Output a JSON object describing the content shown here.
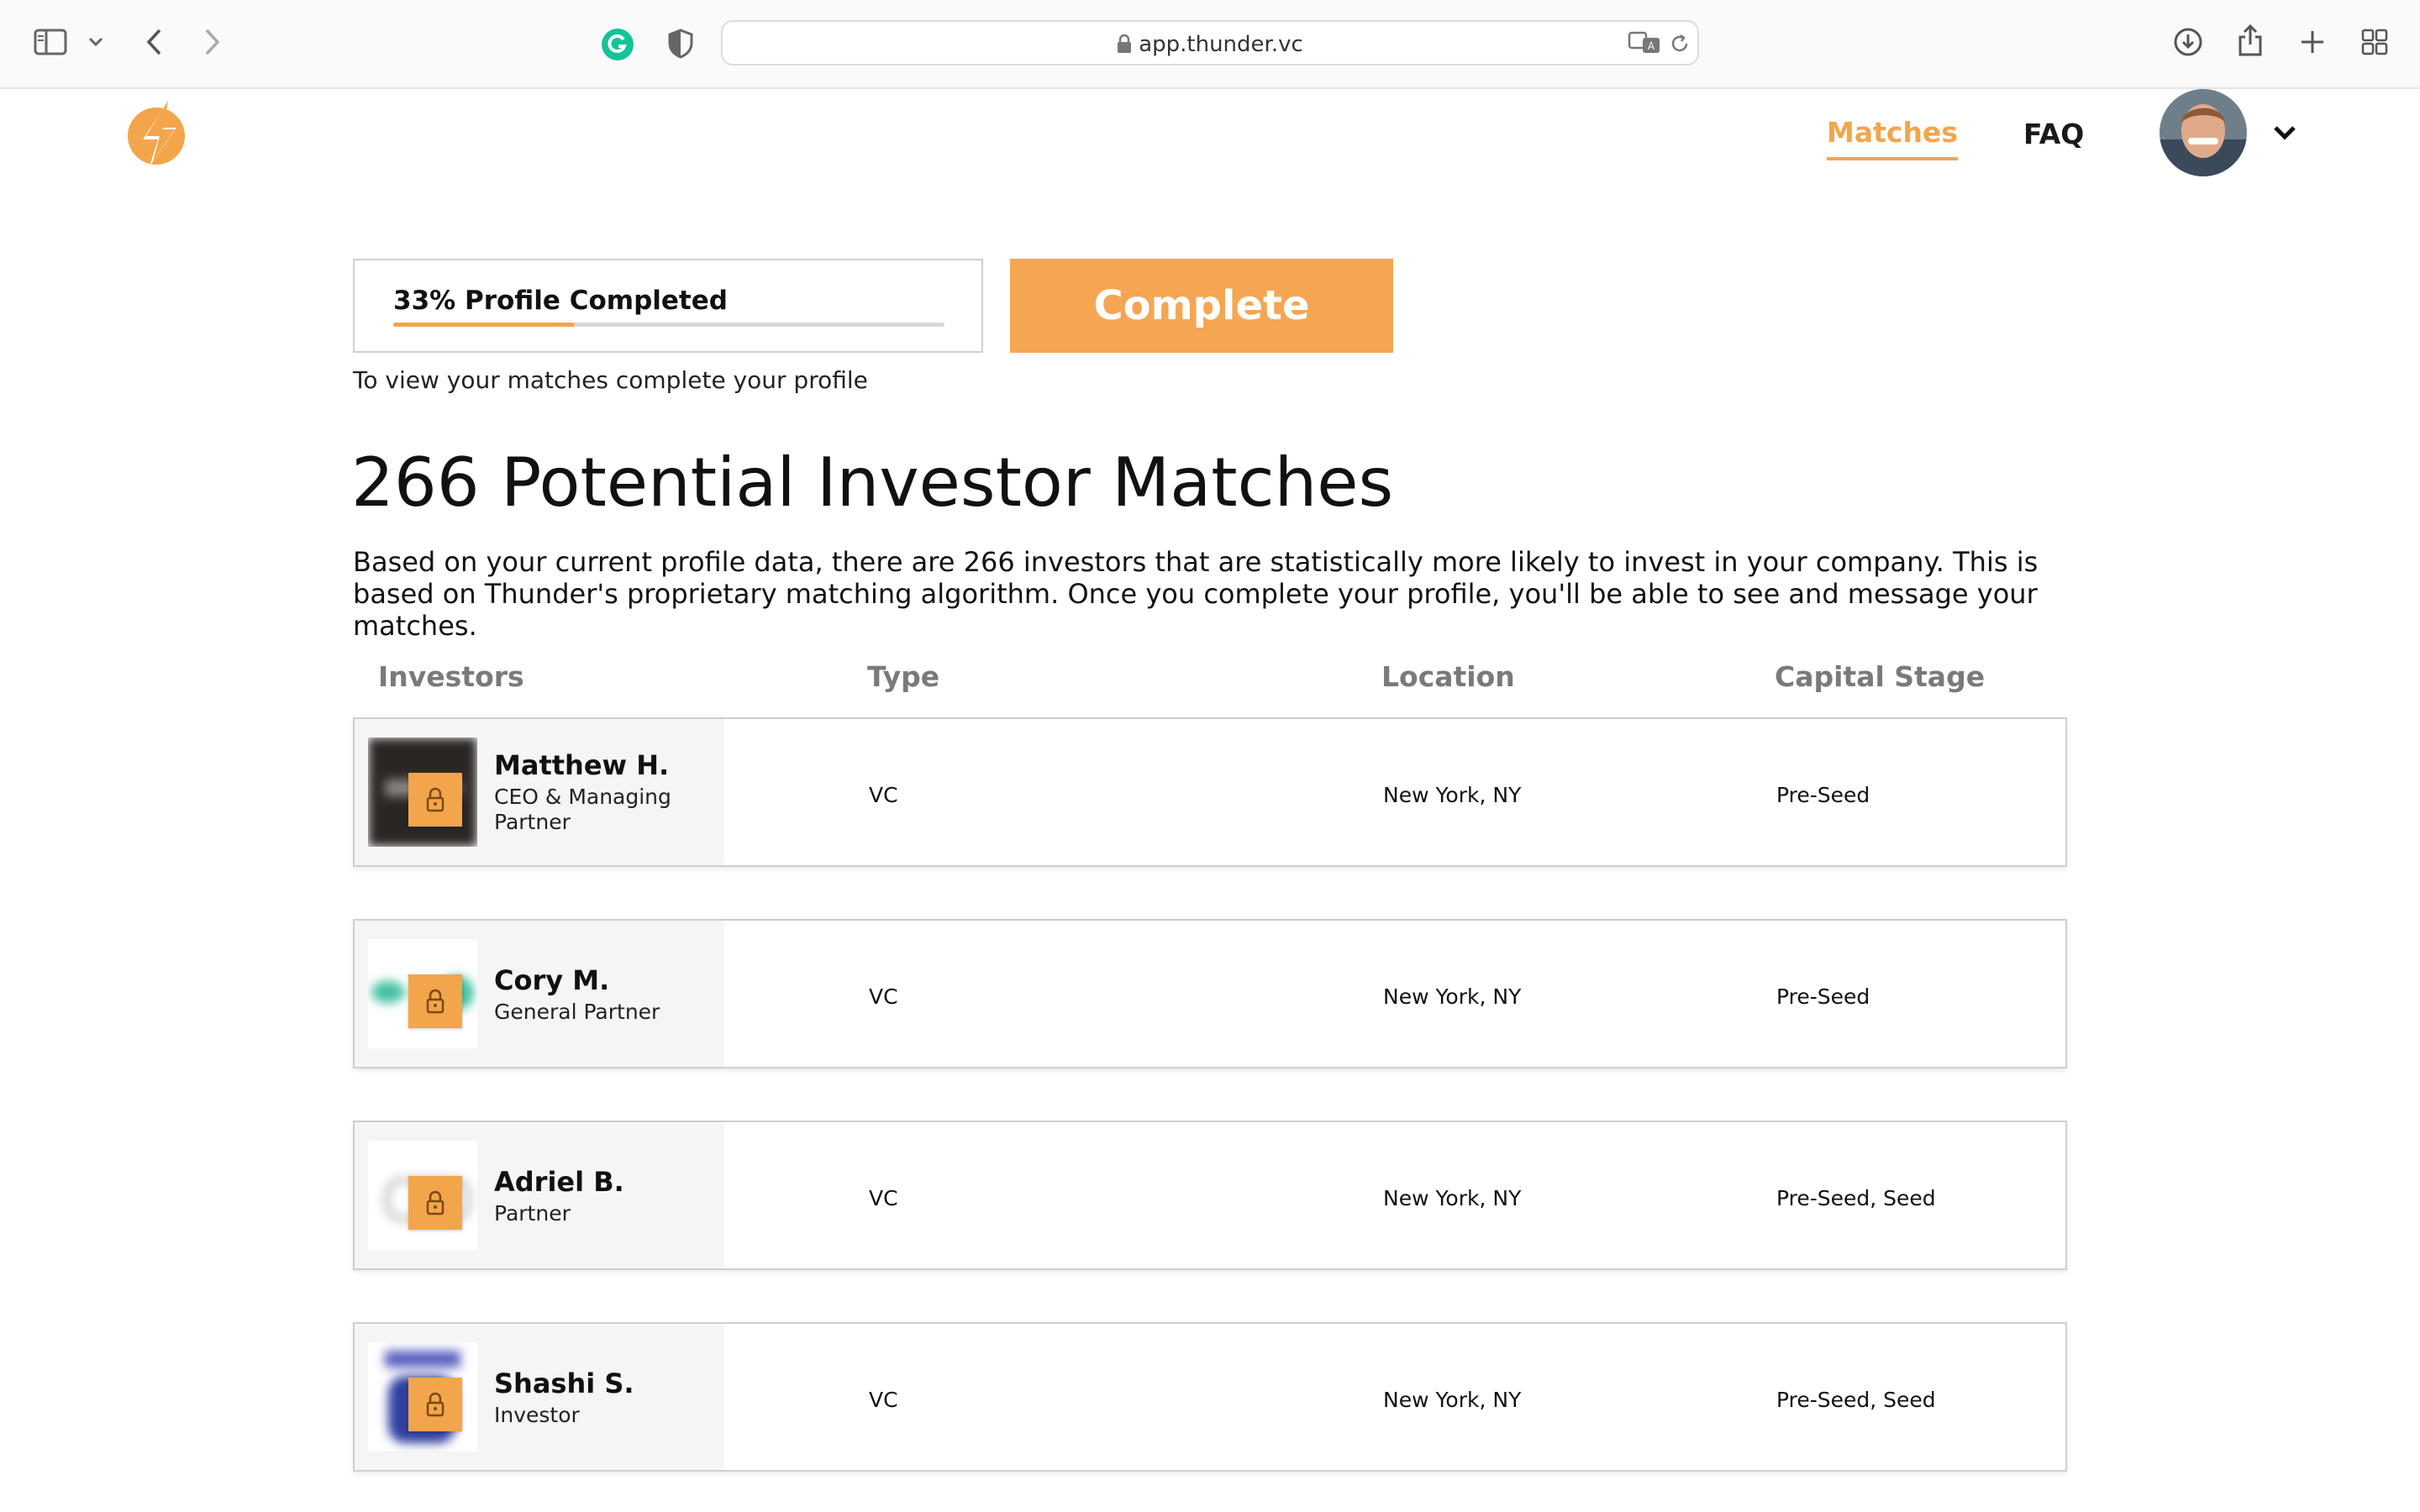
{
  "browser": {
    "url": "app.thunder.vc"
  },
  "nav": {
    "matches_label": "Matches",
    "faq_label": "FAQ"
  },
  "profile": {
    "progress_label": "33% Profile Completed",
    "progress_fraction": 0.33,
    "complete_button": "Complete",
    "hint": "To view your matches complete your profile"
  },
  "main": {
    "title": "266 Potential Investor Matches",
    "description": "Based on your current profile data, there are 266 investors that are statistically more likely to invest in your company. This is based on Thunder's proprietary matching algorithm. Once you complete your profile, you'll be able to see and message your matches."
  },
  "table": {
    "headers": [
      "Investors",
      "Type",
      "Location",
      "Capital Stage"
    ],
    "rows": [
      {
        "name": "Matthew H.",
        "role": "CEO & Managing Partner",
        "type": "VC",
        "location": "New York, NY",
        "stage": "Pre-Seed"
      },
      {
        "name": "Cory M.",
        "role": "General Partner",
        "type": "VC",
        "location": "New York, NY",
        "stage": "Pre-Seed"
      },
      {
        "name": "Adriel B.",
        "role": "Partner",
        "type": "VC",
        "location": "New York, NY",
        "stage": "Pre-Seed, Seed"
      },
      {
        "name": "Shashi S.",
        "role": "Investor",
        "type": "VC",
        "location": "New York, NY",
        "stage": "Pre-Seed, Seed"
      }
    ]
  },
  "colors": {
    "accent": "#f3a54b",
    "button": "#f5a652",
    "header_text": "#7a7a7a"
  },
  "icons": [
    "sidebar-icon",
    "chevron-down-icon",
    "back-icon",
    "forward-icon",
    "grammarly-icon",
    "shield-icon",
    "lock-icon",
    "translate-icon",
    "reload-icon",
    "download-icon",
    "share-icon",
    "plus-icon",
    "tab-overview-icon",
    "thunder-logo-icon",
    "avatar",
    "padlock-icon"
  ]
}
